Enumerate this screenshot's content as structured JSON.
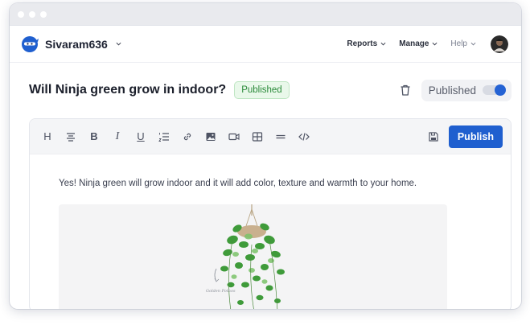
{
  "app": {
    "workspace_name": "Sivaram636",
    "brand_color": "#1f5fcf"
  },
  "nav": {
    "items": [
      {
        "label": "Reports"
      },
      {
        "label": "Manage"
      },
      {
        "label": "Help"
      }
    ]
  },
  "article": {
    "title": "Will Ninja green grow in indoor?",
    "status": "Published",
    "status_color": "#2b8a3a",
    "toggle_label": "Published",
    "toggle_on": true,
    "body": "Yes! Ninja green will grow indoor and it  will add color, texture and warmth to your home.",
    "image_caption": "Golden Pothos"
  },
  "toolbar": {
    "tools": [
      "heading-icon",
      "align-center-icon",
      "bold-icon",
      "italic-icon",
      "underline-icon",
      "ordered-list-icon",
      "link-icon",
      "image-icon",
      "video-icon",
      "table-icon",
      "divider-icon",
      "code-icon"
    ],
    "publish_label": "Publish"
  }
}
